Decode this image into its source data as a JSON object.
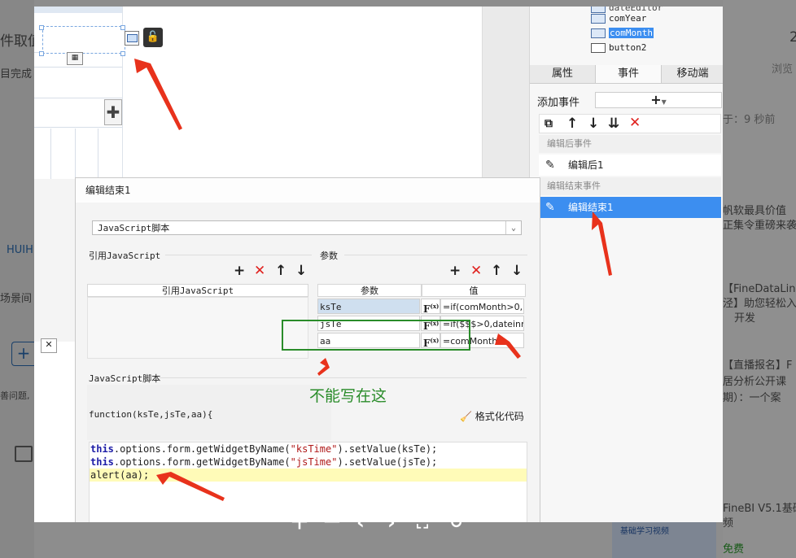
{
  "background": {
    "left_texts": [
      "件取值",
      "目完成",
      "HUIH",
      "场景间",
      "善问题,"
    ],
    "right_texts": [
      "2",
      "浏览",
      "于：9 秒前",
      "帆软最具价值",
      "正集令重磅来袭",
      "【FineDataLin",
      "泾】助您轻松入",
      "开发",
      "【直播报名】F",
      "居分析公开课",
      "期）：一个案",
      "FineBI V5.1基础",
      "频",
      "基础学习视频",
      "免费"
    ]
  },
  "canvas": {
    "lock_icon": "lock-open-icon",
    "calendar_icon": "calendar-icon"
  },
  "right_panel": {
    "tree": [
      "comYear",
      "comMonth",
      "button2"
    ],
    "tree_top_partial": "dateEditor",
    "selected_tree_item": "comMonth",
    "tabs": [
      "属性",
      "事件",
      "移动端"
    ],
    "active_tab": "事件",
    "add_event_label": "添加事件",
    "sections": [
      {
        "title": "编辑后事件",
        "items": [
          "编辑后1"
        ]
      },
      {
        "title": "编辑结束事件",
        "items": [
          "编辑结束1"
        ]
      }
    ],
    "selected_event": "编辑结束1"
  },
  "dialog": {
    "title": "编辑结束1",
    "script_type": "JavaScript脚本",
    "ref_js_label": "引用JavaScript",
    "ref_js_column": "引用JavaScript",
    "params_label": "参数",
    "params_columns": [
      "参数",
      "值"
    ],
    "params": [
      {
        "name": "ksTe",
        "value": "=if(comMonth>0,D"
      },
      {
        "name": "jsTe",
        "value": "=if($$$>0,dateinn"
      },
      {
        "name": "aa",
        "value": "=comMonth"
      }
    ],
    "js_label": "JavaScript脚本",
    "function_signature": "function(ksTe,jsTe,aa){",
    "format_code_label": "格式化代码",
    "code_lines": [
      {
        "kw": "this",
        "rest1": ".options.form.getWidgetByName(",
        "str": "\"ksTime\"",
        "rest2": ").setValue(ksTe);"
      },
      {
        "kw": "this",
        "rest1": ".options.form.getWidgetByName(",
        "str": "\"jsTime\"",
        "rest2": ").setValue(jsTe);"
      },
      {
        "kw": "",
        "rest1": "alert(aa);",
        "str": "",
        "rest2": ""
      }
    ]
  },
  "annotation": {
    "text": "不能写在这",
    "color": "#2a8c2a",
    "arrow_color": "#e8321c"
  },
  "colors": {
    "selection_blue": "#3c8ef0",
    "delete_red": "#e0221f",
    "highlight_yellow": "#fffbb8"
  }
}
